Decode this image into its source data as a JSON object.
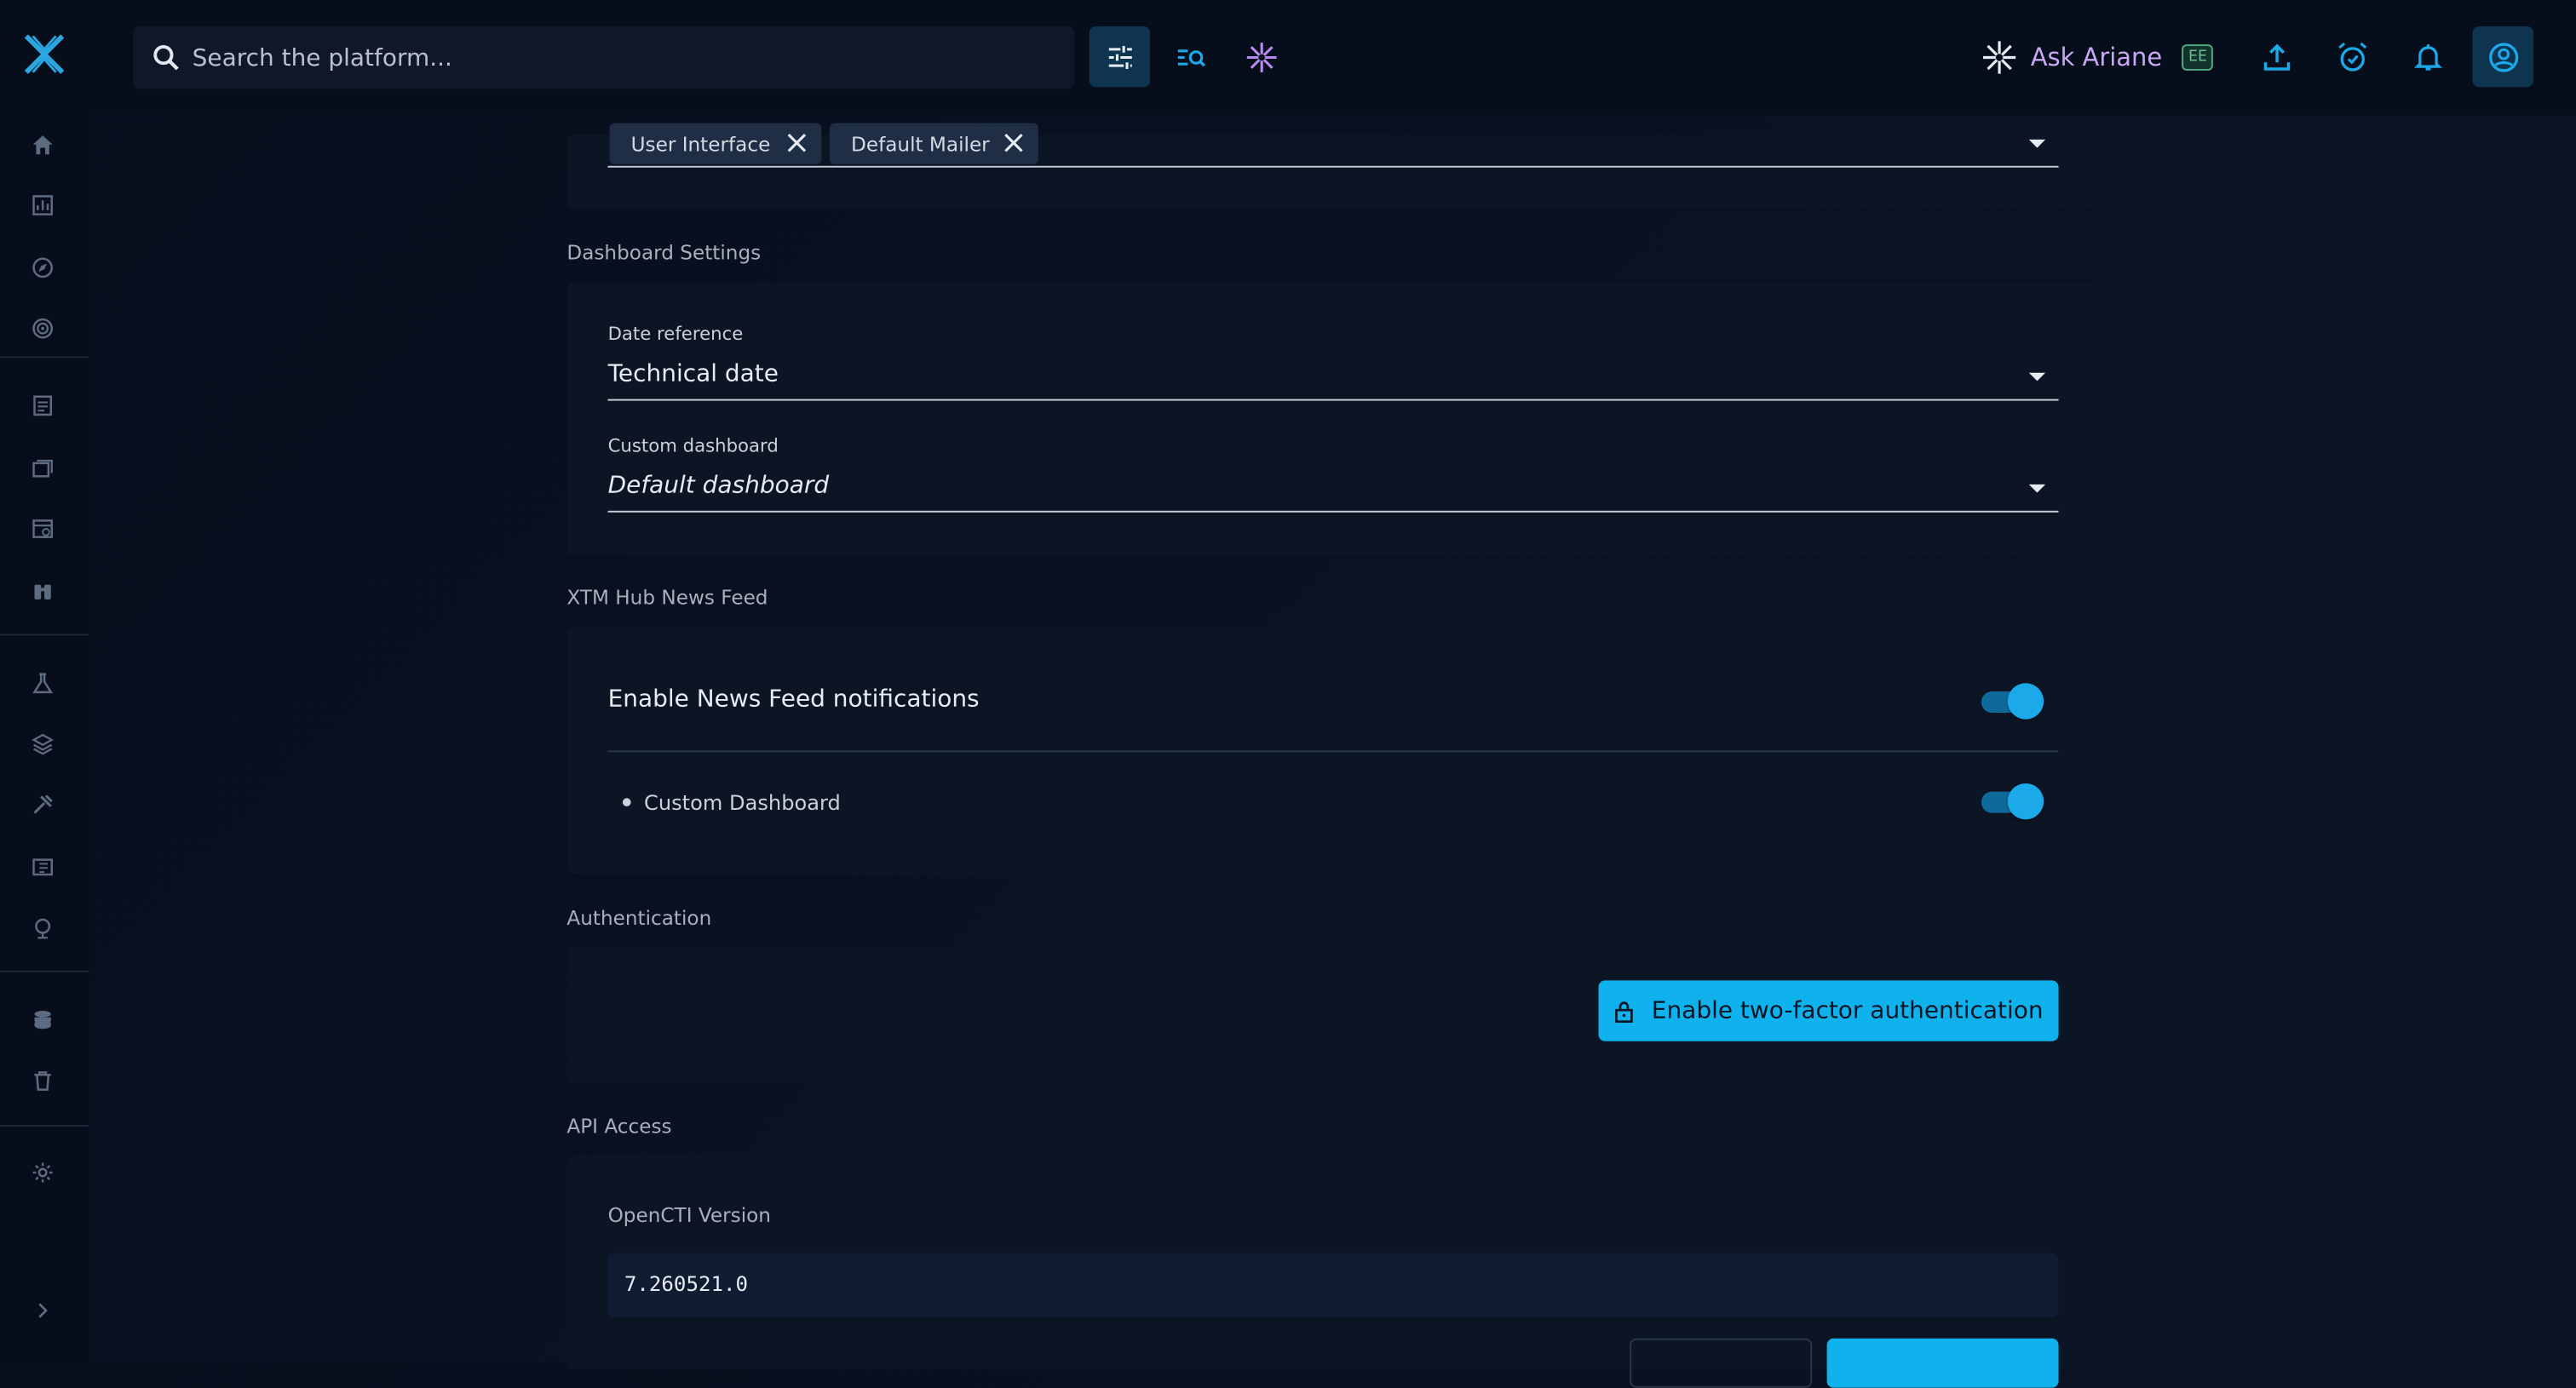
{
  "search": {
    "placeholder": "Search the platform..."
  },
  "topbar": {
    "ask_label": "Ask Ariane",
    "ee_badge": "EE"
  },
  "sidebar": {
    "items": [
      "home-icon",
      "dashboard-icon",
      "explore-icon",
      "radar-icon",
      "report-icon",
      "cases-icon",
      "events-icon",
      "observations-icon",
      "threats-icon",
      "arsenal-icon",
      "techniques-icon",
      "entities-icon",
      "locations-icon",
      "data-icon",
      "trash-icon",
      "settings-icon"
    ],
    "collapse_icon": "chevron-right-icon"
  },
  "tags": [
    {
      "label": "User Interface"
    },
    {
      "label": "Default Mailer"
    }
  ],
  "dashboard_settings": {
    "title": "Dashboard Settings",
    "date_reference_label": "Date reference",
    "date_reference_value": "Technical date",
    "custom_dashboard_label": "Custom dashboard",
    "custom_dashboard_value": "Default dashboard"
  },
  "news_feed": {
    "title": "XTM Hub News Feed",
    "enable_label": "Enable News Feed notifications",
    "enable_on": true,
    "sub_item_label": "Custom Dashboard",
    "sub_item_on": true
  },
  "authentication": {
    "title": "Authentication",
    "enable_2fa_label": "Enable two-factor authentication"
  },
  "api_access": {
    "title": "API Access",
    "version_label": "OpenCTI Version",
    "version_value": "7.260521.0"
  },
  "colors": {
    "accent": "#0fb2ec",
    "ai": "#c9a7f5",
    "bg": "#070e1c"
  }
}
